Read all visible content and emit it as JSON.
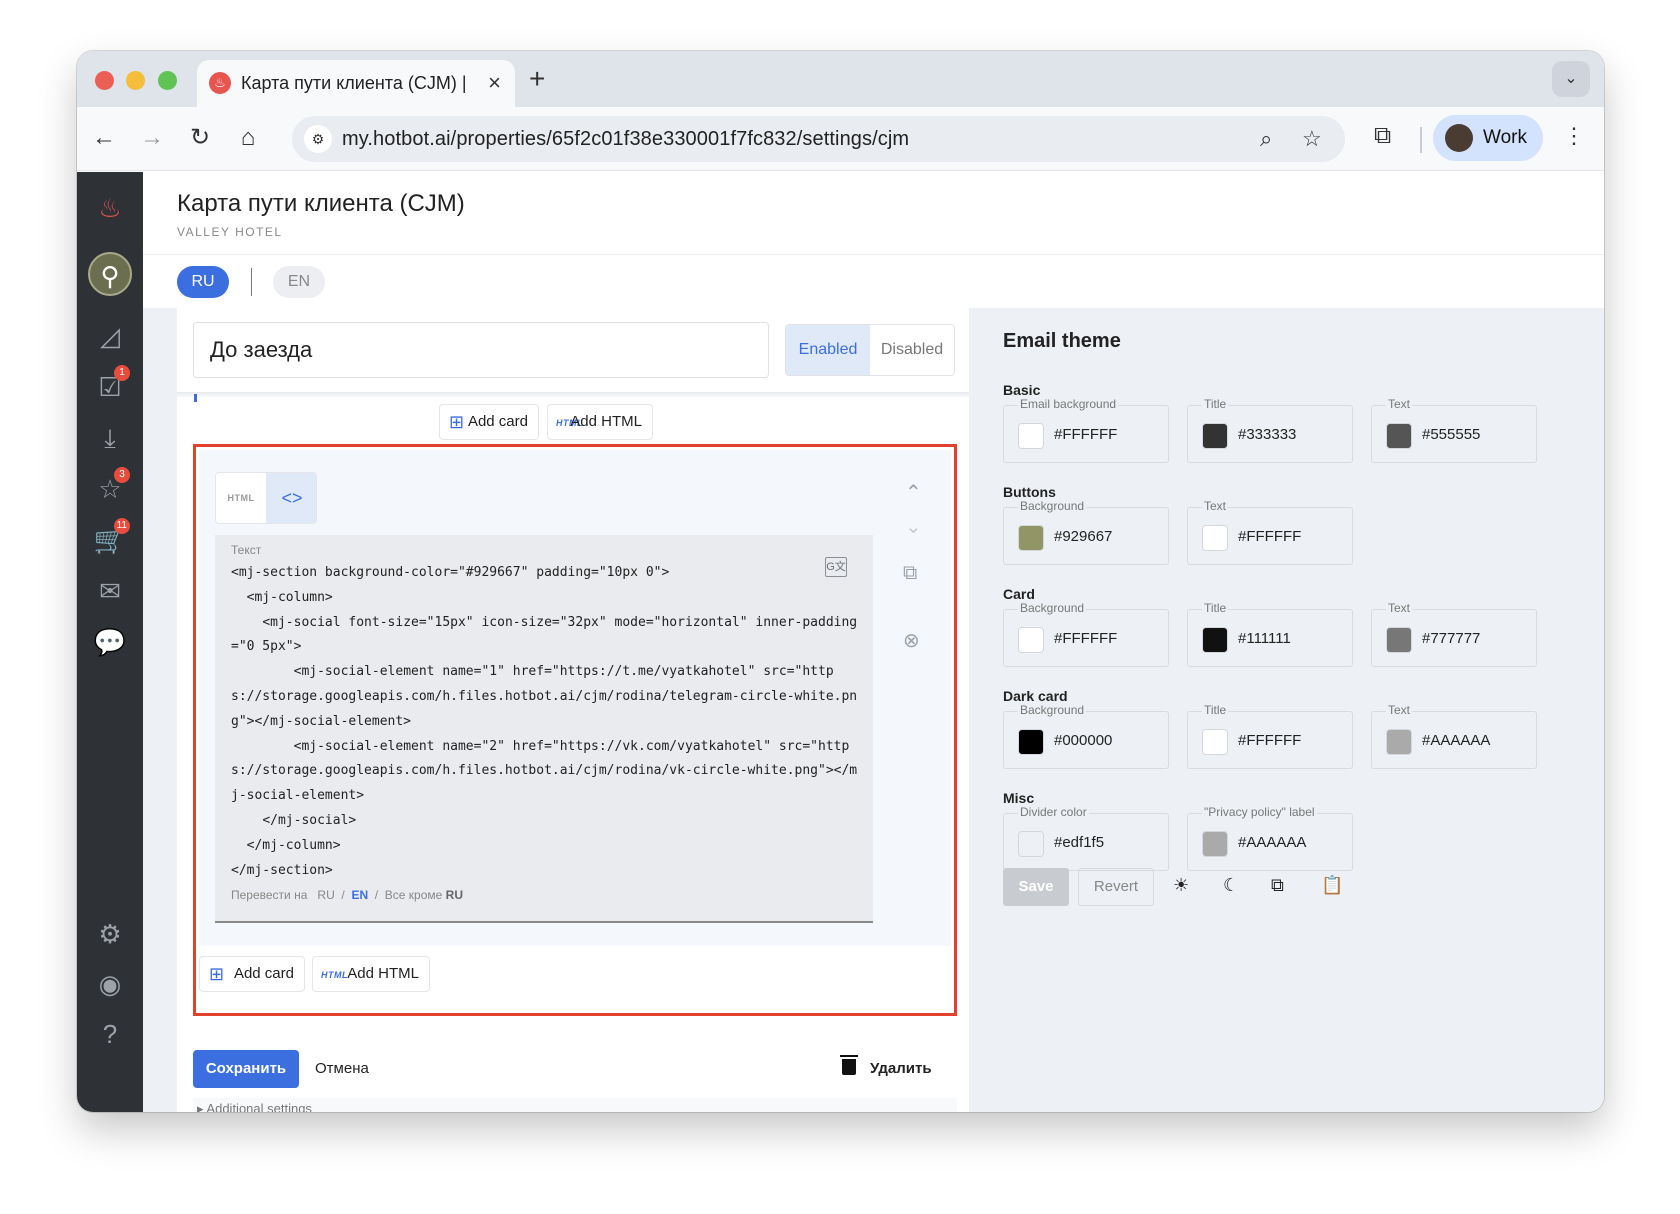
{
  "browser": {
    "tab_title": "Карта пути клиента (CJM) | \\",
    "url": "my.hotbot.ai/properties/65f2c01f38e330001f7fc832/settings/cjm",
    "profile": "Work"
  },
  "sidebar": {
    "badges": {
      "tasks": "1",
      "reviews": "3",
      "orders": "11"
    }
  },
  "header": {
    "title": "Карта пути клиента (CJM)",
    "subtitle": "VALLEY HOTEL",
    "lang_ru": "RU",
    "lang_en": "EN"
  },
  "step": {
    "name": "До заезда",
    "enabled": "Enabled",
    "disabled": "Disabled",
    "add_card": "Add card",
    "add_html": "Add HTML",
    "html_tag": "HTML"
  },
  "html_block": {
    "mode_html": "HTML",
    "mode_code": "<>",
    "editor_label": "Текст",
    "code": "<mj-section background-color=\"#929667\" padding=\"10px 0\">\n  <mj-column>\n    <mj-social font-size=\"15px\" icon-size=\"32px\" mode=\"horizontal\" inner-padding=\"0 5px\">\n        <mj-social-element name=\"1\" href=\"https://t.me/vyatkahotel\" src=\"https://storage.googleapis.com/h.files.hotbot.ai/cjm/rodina/telegram-circle-white.png\"></mj-social-element>\n        <mj-social-element name=\"2\" href=\"https://vk.com/vyatkahotel\" src=\"https://storage.googleapis.com/h.files.hotbot.ai/cjm/rodina/vk-circle-white.png\"></mj-social-element>\n    </mj-social>\n  </mj-column>\n</mj-section>",
    "translate_prefix": "Перевести на",
    "translate_ru": "RU",
    "translate_en": "EN",
    "translate_all": "Все кроме",
    "translate_all_ru": "RU"
  },
  "actions": {
    "save": "Сохранить",
    "cancel": "Отмена",
    "delete": "Удалить",
    "additional": "▸ Additional settings"
  },
  "theme": {
    "title": "Email theme",
    "groups": {
      "basic": {
        "title": "Basic",
        "email_bg": {
          "label": "Email background",
          "value": "#FFFFFF",
          "color": "#FFFFFF"
        },
        "title_c": {
          "label": "Title",
          "value": "#333333",
          "color": "#333333"
        },
        "text": {
          "label": "Text",
          "value": "#555555",
          "color": "#555555"
        }
      },
      "buttons": {
        "title": "Buttons",
        "bg": {
          "label": "Background",
          "value": "#929667",
          "color": "#929667"
        },
        "text": {
          "label": "Text",
          "value": "#FFFFFF",
          "color": "#FFFFFF"
        }
      },
      "card": {
        "title": "Card",
        "bg": {
          "label": "Background",
          "value": "#FFFFFF",
          "color": "#FFFFFF"
        },
        "title_c": {
          "label": "Title",
          "value": "#111111",
          "color": "#111111"
        },
        "text": {
          "label": "Text",
          "value": "#777777",
          "color": "#777777"
        }
      },
      "dark_card": {
        "title": "Dark card",
        "bg": {
          "label": "Background",
          "value": "#000000",
          "color": "#000000"
        },
        "title_c": {
          "label": "Title",
          "value": "#FFFFFF",
          "color": "#FFFFFF"
        },
        "text": {
          "label": "Text",
          "value": "#AAAAAA",
          "color": "#AAAAAA"
        }
      },
      "misc": {
        "title": "Misc",
        "divider": {
          "label": "Divider color",
          "value": "#edf1f5",
          "color": "#edf1f5"
        },
        "privacy": {
          "label": "\"Privacy policy\" label",
          "value": "#AAAAAA",
          "color": "#AAAAAA"
        }
      }
    },
    "save": "Save",
    "revert": "Revert"
  },
  "colors": {
    "accent": "#3b6fe0",
    "highlight": "#e0422d",
    "sidebar": "#2e3236"
  }
}
